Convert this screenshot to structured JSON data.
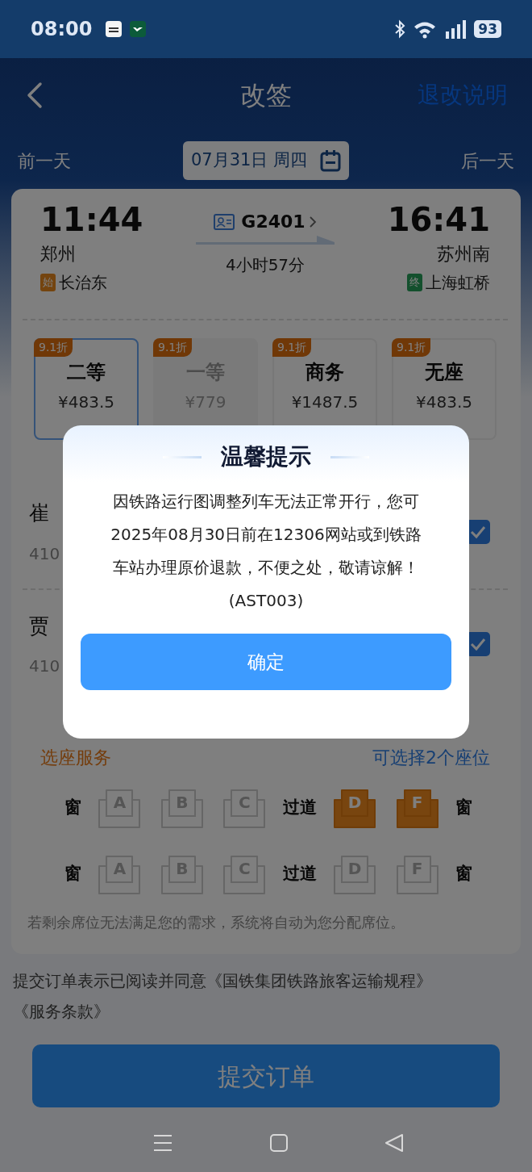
{
  "status_bar": {
    "time": "08:00",
    "battery": "93"
  },
  "nav": {
    "title": "改签",
    "action": "退改说明"
  },
  "date_bar": {
    "prev": "前一天",
    "date": "07月31日 周四",
    "next": "后一天"
  },
  "train": {
    "depart_time": "11:44",
    "depart_station": "郑州",
    "origin_tag": "始",
    "origin": "长治东",
    "number": "G2401",
    "duration": "4小时57分",
    "arrive_time": "16:41",
    "arrive_station": "苏州南",
    "terminal_tag": "终",
    "terminal": "上海虹桥"
  },
  "seat_classes": [
    {
      "discount": "9.1折",
      "name": "二等",
      "price": "¥483.5",
      "selected": true,
      "disabled": false
    },
    {
      "discount": "9.1折",
      "name": "一等",
      "price": "¥779",
      "selected": false,
      "disabled": true
    },
    {
      "discount": "9.1折",
      "name": "商务",
      "price": "¥1487.5",
      "selected": false,
      "disabled": false
    },
    {
      "discount": "9.1折",
      "name": "无座",
      "price": "¥483.5",
      "selected": false,
      "disabled": false
    }
  ],
  "passengers": [
    {
      "name": "崔",
      "id": "410",
      "checked": true
    },
    {
      "name": "贾",
      "id": "410",
      "checked": true
    }
  ],
  "seat_service": {
    "title": "选座服务",
    "hint": "可选择2个座位",
    "rows": [
      {
        "window_left": "窗",
        "seats_left": [
          {
            "label": "A",
            "selected": false
          },
          {
            "label": "B",
            "selected": false
          },
          {
            "label": "C",
            "selected": false
          }
        ],
        "aisle": "过道",
        "seats_right": [
          {
            "label": "D",
            "selected": true
          },
          {
            "label": "F",
            "selected": true
          }
        ],
        "window_right": "窗"
      },
      {
        "window_left": "窗",
        "seats_left": [
          {
            "label": "A",
            "selected": false
          },
          {
            "label": "B",
            "selected": false
          },
          {
            "label": "C",
            "selected": false
          }
        ],
        "aisle": "过道",
        "seats_right": [
          {
            "label": "D",
            "selected": false
          },
          {
            "label": "F",
            "selected": false
          }
        ],
        "window_right": "窗"
      }
    ],
    "note": "若剩余席位无法满足您的需求，系统将自动为您分配席位。"
  },
  "agreement": {
    "text": "提交订单表示已阅读并同意",
    "links": [
      "《国铁集团铁路旅客运输规程》",
      "《服务条款》"
    ]
  },
  "submit": "提交订单",
  "dialog": {
    "title": "温馨提示",
    "message": "因铁路运行图调整列车无法正常开行，您可2025年08月30日前在12306网站或到铁路车站办理原价退款，不便之处，敬请谅解！(AST003)",
    "button": "确定"
  }
}
